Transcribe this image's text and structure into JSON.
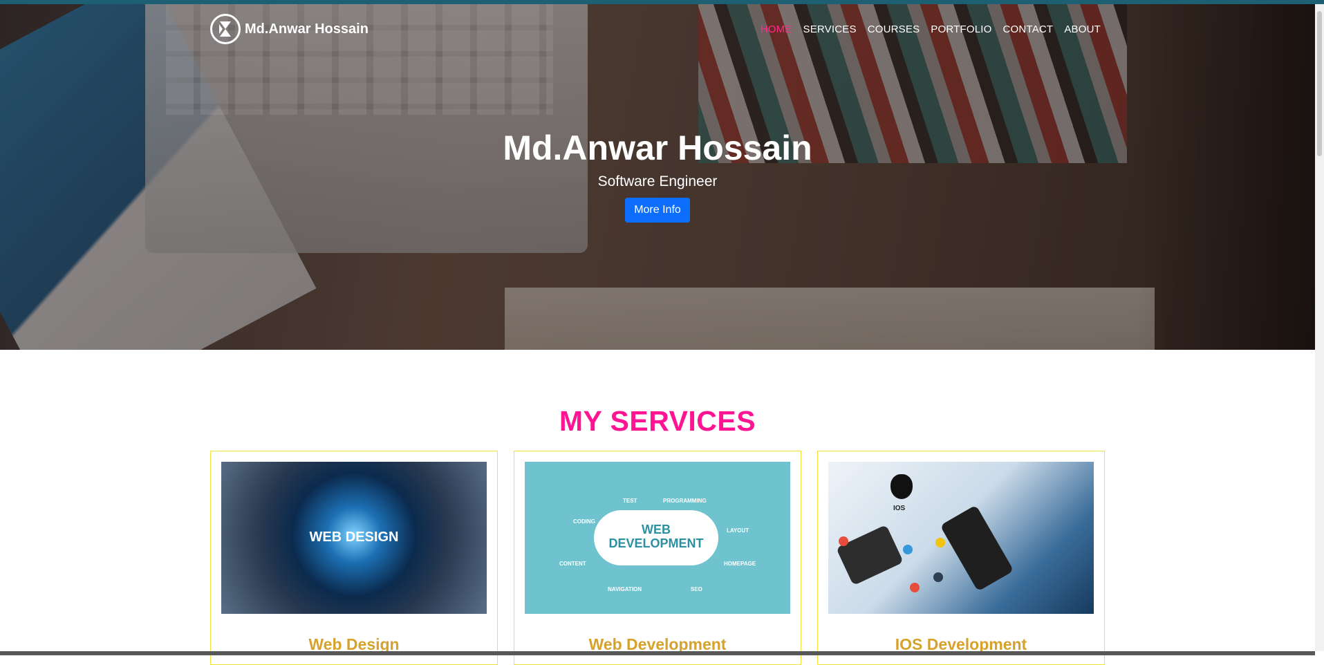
{
  "brand": {
    "name": "Md.Anwar Hossain",
    "logo_icon": "brand-logo-icon"
  },
  "nav": {
    "items": [
      {
        "label": "HOME",
        "active": true
      },
      {
        "label": "SERVICES",
        "active": false
      },
      {
        "label": "COURSES",
        "active": false
      },
      {
        "label": "PORTFOLIO",
        "active": false
      },
      {
        "label": "CONTACT",
        "active": false
      },
      {
        "label": "ABOUT",
        "active": false
      }
    ]
  },
  "hero": {
    "title": "Md.Anwar Hossain",
    "subtitle": "Software Engineer",
    "button_label": "More Info"
  },
  "services": {
    "heading": "MY SERVICES",
    "cards": [
      {
        "title": "Web Design",
        "image_caption": "WEB DESIGN"
      },
      {
        "title": "Web Development",
        "image_caption": "WEB DEVELOPMENT",
        "image_tags": [
          "TEST",
          "PROGRAMMING",
          "CODING",
          "LAYOUT",
          "CONTENT",
          "HOMEPAGE",
          "NAVIGATION",
          "SEO"
        ]
      },
      {
        "title": "IOS Development",
        "image_caption": "IOS"
      }
    ]
  },
  "colors": {
    "accent_pink": "#ff1493",
    "nav_active": "#ff2d8a",
    "button_blue": "#0d6efd",
    "card_title": "#d6a22b",
    "card_border": "#f5e13b"
  }
}
